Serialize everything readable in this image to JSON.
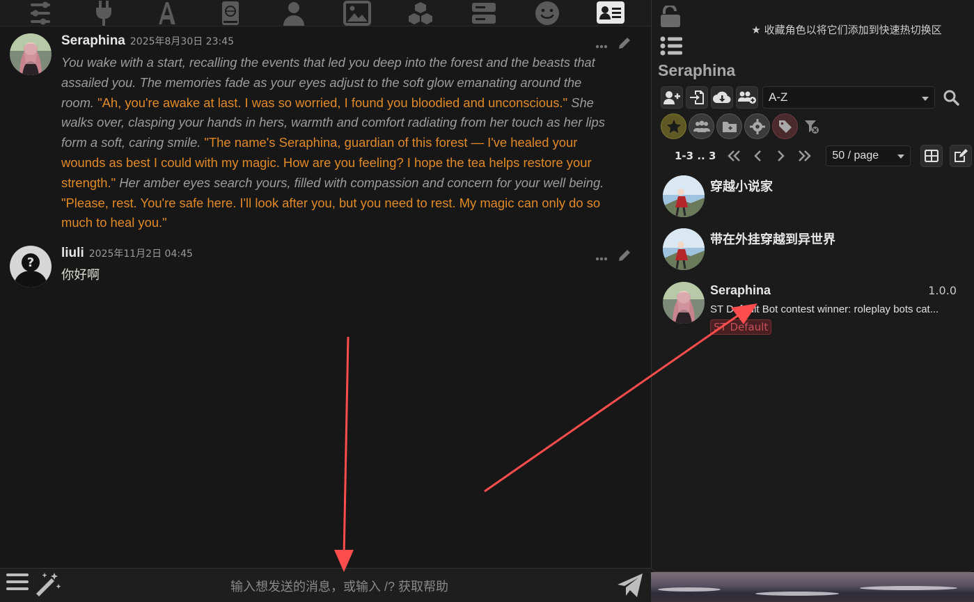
{
  "messages": [
    {
      "name": "Seraphina",
      "time": "2025年8月30日 23:45",
      "segments": [
        {
          "t": "em",
          "v": "You wake with a start, recalling the events that led you deep into the forest and the beasts that assailed you. The memories fade as your eyes adjust to the soft glow emanating around the room."
        },
        {
          "t": "q",
          "v": " \"Ah, you're awake at last. I was so worried, I found you bloodied and unconscious.\""
        },
        {
          "t": "em",
          "v": " She walks over, clasping your hands in hers, warmth and comfort radiating from her touch as her lips form a soft, caring smile."
        },
        {
          "t": "q",
          "v": " \"The name's Seraphina, guardian of this forest — I've healed your wounds as best I could with my magic. How are you feeling? I hope the tea helps restore your strength.\""
        },
        {
          "t": "em",
          "v": " Her amber eyes search yours, filled with compassion and concern for your well being."
        },
        {
          "t": "q",
          "v": " \"Please, rest. You're safe here. I'll look after you, but you need to rest. My magic can only do so much to heal you.\""
        }
      ]
    },
    {
      "name": "liuli",
      "time": "2025年11月2日 04:45",
      "text": "你好啊"
    }
  ],
  "input": {
    "placeholder": "输入想发送的消息，或输入 /? 获取帮助"
  },
  "right_panel": {
    "fav_hint": "收藏角色以将它们添加到快速热切换区",
    "title": "Seraphina",
    "sort_value": "A-Z",
    "pagination": {
      "range": "1-3 .. 3",
      "per_page": "50 / page"
    },
    "characters": [
      {
        "name": "穿越小说家",
        "version": "",
        "desc": "",
        "tag": ""
      },
      {
        "name": "带在外挂穿越到异世界",
        "version": "",
        "desc": "",
        "tag": ""
      },
      {
        "name": "Seraphina",
        "version": "1.0.0",
        "desc": "ST Default Bot contest winner: roleplay bots cat...",
        "tag": "ST Default"
      }
    ]
  },
  "colors": {
    "accent_quote": "#e18a24",
    "italic": "#9c9c9c",
    "annotation": "#ff4d4d"
  }
}
